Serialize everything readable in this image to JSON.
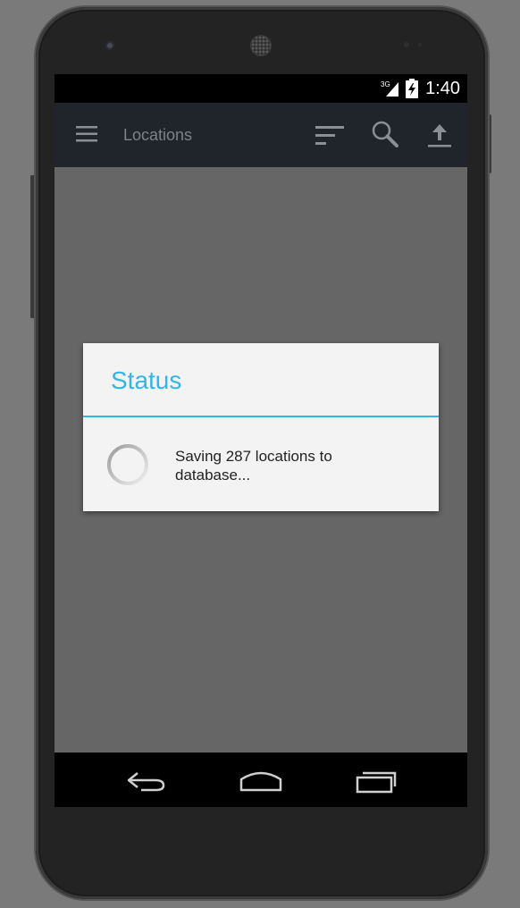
{
  "status_bar": {
    "network": "3G",
    "time": "1:40"
  },
  "app_bar": {
    "title": "Locations",
    "actions": [
      "menu-icon",
      "sort-icon",
      "search-icon",
      "upload-icon"
    ]
  },
  "dialog": {
    "title": "Status",
    "message": "Saving 287 locations to database...",
    "accent_color": "#33b5e5"
  },
  "nav_bar": {
    "buttons": [
      "back-icon",
      "home-icon",
      "recents-icon"
    ]
  }
}
